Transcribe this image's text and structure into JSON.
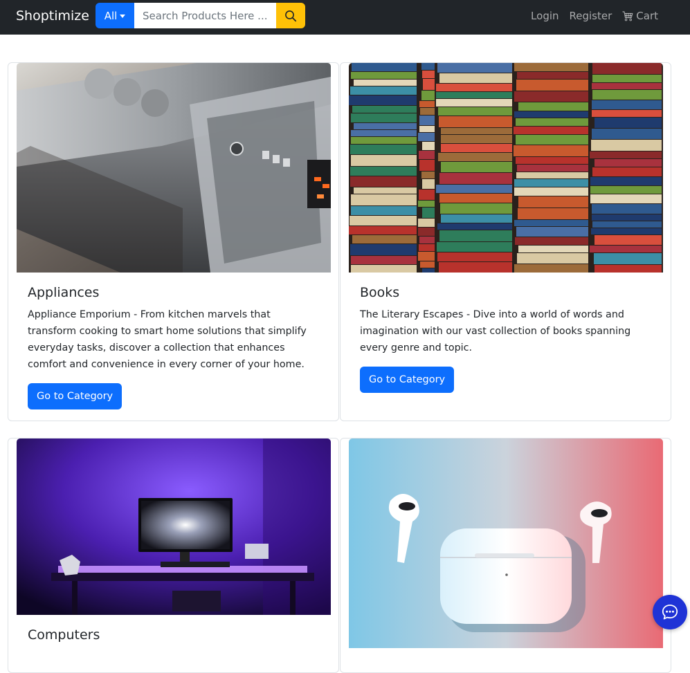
{
  "app": {
    "brand": "Shoptimize"
  },
  "search": {
    "category_label": "All",
    "placeholder": "Search Products Here ..."
  },
  "nav": {
    "login": "Login",
    "register": "Register",
    "cart": "Cart"
  },
  "categories": [
    {
      "title": "Appliances",
      "description": "Appliance Emporium - From kitchen marvels that transform cooking to smart home solutions that simplify everyday tasks, discover a collection that enhances comfort and convenience in every corner of your home.",
      "button": "Go to Category"
    },
    {
      "title": "Books",
      "description": "The Literary Escapes - Dive into a world of words and imagination with our vast collection of books spanning every genre and topic.",
      "button": "Go to Category"
    },
    {
      "title": "Computers",
      "description": "",
      "button": ""
    },
    {
      "title": "",
      "description": "",
      "button": ""
    }
  ],
  "icons": {
    "search": "search-icon",
    "cart": "cart-icon",
    "chat": "chat-icon"
  },
  "colors": {
    "navbar": "#212529",
    "primary": "#0d6efd",
    "search_button": "#ffc107",
    "chat_button": "#1f33d6"
  }
}
